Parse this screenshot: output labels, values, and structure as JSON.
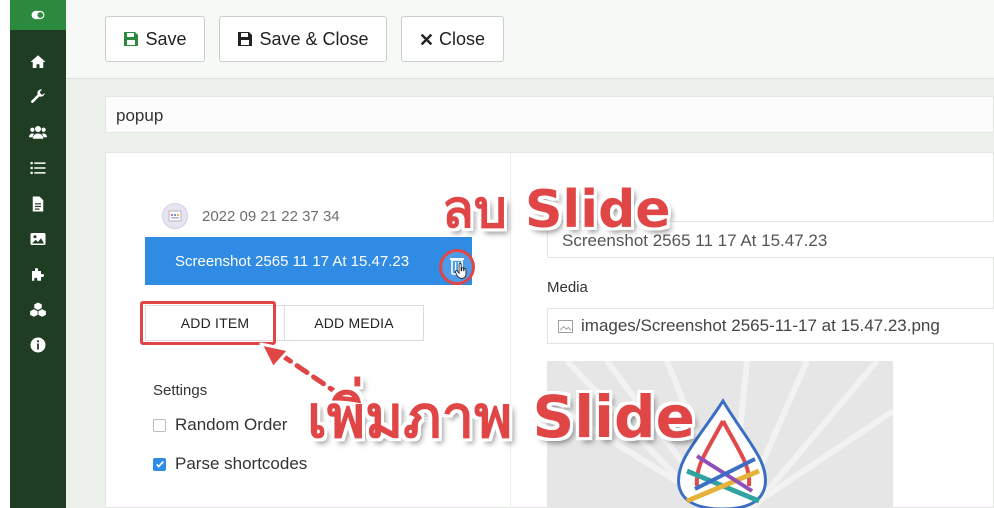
{
  "toolbar": {
    "save_label": "Save",
    "save_close_label": "Save & Close",
    "close_label": "Close"
  },
  "module_title": "popup",
  "slides": {
    "timestamp_item": "2022 09 21 22 37 34",
    "selected_item": "Screenshot 2565 11 17 At 15.47.23",
    "add_item_label": "ADD ITEM",
    "add_media_label": "ADD MEDIA"
  },
  "settings": {
    "label": "Settings",
    "random_order_label": "Random Order",
    "random_order_checked": false,
    "parse_shortcodes_label": "Parse shortcodes",
    "parse_shortcodes_checked": true
  },
  "editor": {
    "title_value": "Screenshot 2565 11 17 At 15.47.23",
    "media_label": "Media",
    "media_path": "images/Screenshot 2565-11-17 at 15.47.23.png"
  },
  "annotations": {
    "delete_slide": "ลบ Slide",
    "add_slide": "เพิ่มภาพ Slide"
  },
  "colors": {
    "sidebar_bg": "#1f3d23",
    "sidebar_active": "#2c8a3e",
    "selected_item_bg": "#2f8be4",
    "annotation_red": "#e04646"
  },
  "icons": {
    "sidebar": [
      "toggle-icon",
      "home-icon",
      "wrench-icon",
      "users-icon",
      "list-icon",
      "file-icon",
      "image-icon",
      "puzzle-icon",
      "cubes-icon",
      "info-icon"
    ]
  }
}
